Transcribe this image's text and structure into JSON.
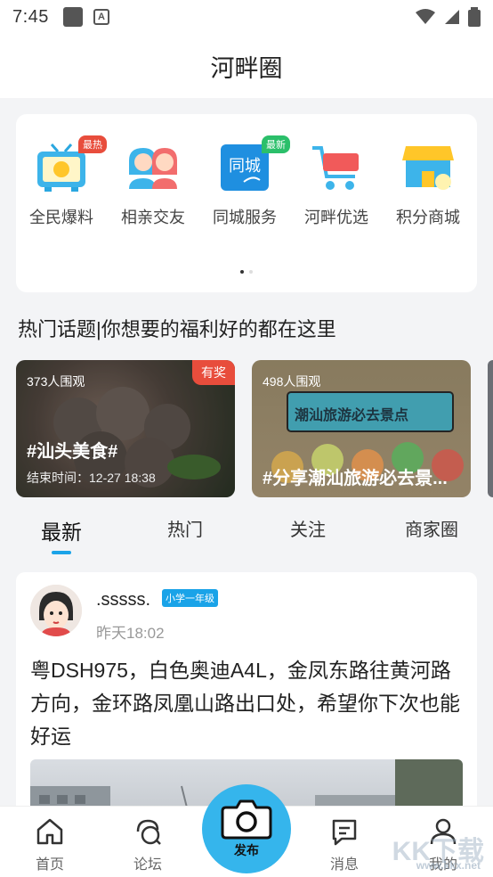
{
  "status_bar": {
    "time": "7:45"
  },
  "header": {
    "title": "河畔圈"
  },
  "features": [
    {
      "label": "全民爆料",
      "icon": "tv-icon",
      "badge": "最热"
    },
    {
      "label": "相亲交友",
      "icon": "couple-icon",
      "badge": ""
    },
    {
      "label": "同城服务",
      "icon": "city-service-icon",
      "badge": "最新"
    },
    {
      "label": "河畔优选",
      "icon": "shopping-cart-icon",
      "badge": ""
    },
    {
      "label": "积分商城",
      "icon": "store-icon",
      "badge": ""
    }
  ],
  "topics": {
    "title": "热门话题|你想要的福利好的都在这里",
    "cards": [
      {
        "viewers": "373人围观",
        "tag": "#汕头美食#",
        "end_time": "结束时间：12-27 18:38",
        "prize": "有奖"
      },
      {
        "viewers": "498人围观",
        "tag": "#分享潮汕旅游必去景...",
        "banner": "潮汕旅游必去景点"
      }
    ]
  },
  "tabs": [
    {
      "label": "最新",
      "active": true
    },
    {
      "label": "热门",
      "active": false
    },
    {
      "label": "关注",
      "active": false
    },
    {
      "label": "商家圈",
      "active": false
    }
  ],
  "post": {
    "username": ".sssss.",
    "level": "小学一年级",
    "time": "昨天18:02",
    "text": "粤DSH975，白色奥迪A4L，金凤东路往黄河路方向，金环路凤凰山路出口处，希望你下次也能好运"
  },
  "bottom_nav": {
    "home": "首页",
    "forum": "论坛",
    "publish": "发布",
    "messages": "消息",
    "mine": "我的"
  },
  "watermark": {
    "main": "KK下载",
    "sub": "www.kkx.net"
  },
  "colors": {
    "accent": "#1aa3e8",
    "fab": "#35b5ec",
    "badge_red": "#e84d3c",
    "badge_green": "#2bbf6a"
  }
}
